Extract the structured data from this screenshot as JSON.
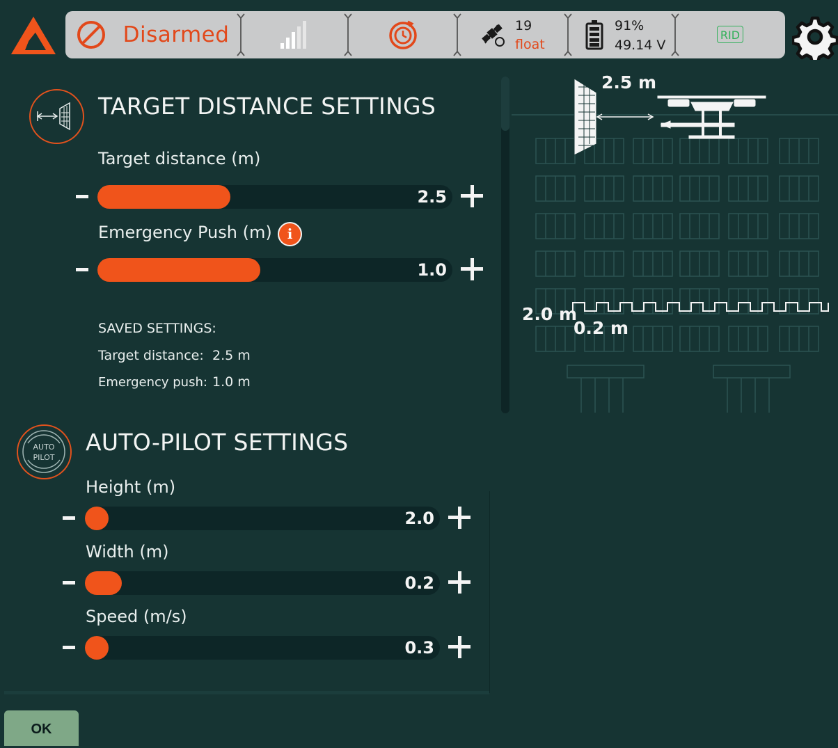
{
  "status": {
    "arm_state": "Disarmed",
    "satellites": "19",
    "gps_fix": "float",
    "battery_percent": "91%",
    "battery_voltage": "49.14 V",
    "rid_label": "RID",
    "signal_strength_bars": 3,
    "signal_strength_max_bars": 5
  },
  "icons": {
    "logo": "app-logo",
    "arm": "prohibited-icon",
    "signal": "signal-bars-icon",
    "timer": "timer-icon",
    "satellite": "satellite-icon",
    "battery": "battery-icon",
    "settings": "gear-icon"
  },
  "colors": {
    "accent": "#f0541b",
    "disarmed": "#e2481a",
    "background": "#163433",
    "rid": "#32b05a",
    "ok_button": "#7fa887"
  },
  "target_distance": {
    "title": "TARGET DISTANCE SETTINGS",
    "params": [
      {
        "label": "Target distance (m)",
        "value": "2.5",
        "level": 0.33
      },
      {
        "label": "Emergency Push (m)",
        "value": "1.0",
        "level": 0.42,
        "info": "i"
      }
    ],
    "saved": {
      "heading": "SAVED SETTINGS:",
      "target_label": "Target distance:",
      "target_value": "2.5 m",
      "push_label": "Emergency push:",
      "push_value": "1.0 m"
    }
  },
  "illustration": {
    "distance_label": "2.5 m",
    "height_label": "2.0 m",
    "width_label": "0.2 m"
  },
  "autopilot": {
    "title": "AUTO-PILOT SETTINGS",
    "icon_text_1": "AUTO",
    "icon_text_2": "PILOT",
    "params": [
      {
        "label": "Height (m)",
        "value": "2.0",
        "level": 0.0
      },
      {
        "label": "Width (m)",
        "value": "0.2",
        "level": 0.04
      },
      {
        "label": "Speed (m/s)",
        "value": "0.3",
        "level": 0.0
      }
    ]
  },
  "controls": {
    "minus": "-",
    "plus": "+",
    "ok_label": "OK"
  }
}
